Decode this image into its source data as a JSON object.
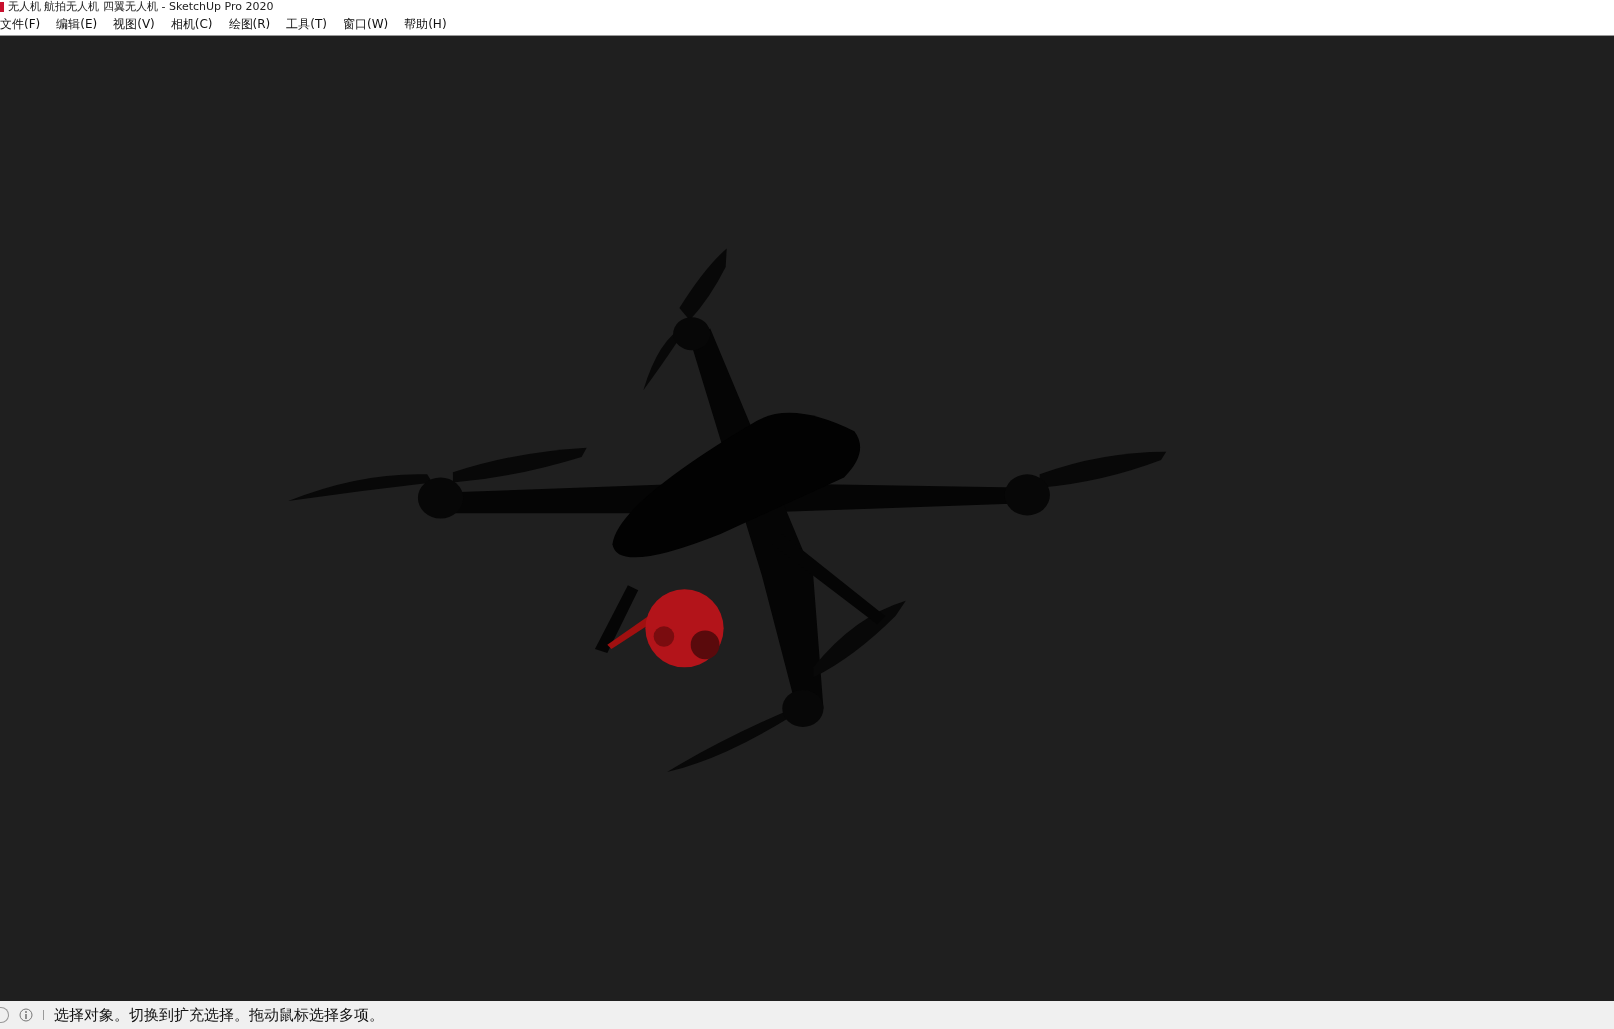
{
  "window": {
    "title": "无人机 航拍无人机 四翼无人机 - SketchUp Pro 2020"
  },
  "menu": [
    "文件(F)",
    "编辑(E)",
    "视图(V)",
    "相机(C)",
    "绘图(R)",
    "工具(T)",
    "窗口(W)",
    "帮助(H)"
  ],
  "viewport": {
    "kind": "model"
  },
  "status_bar": {
    "message": "选择对象。切换到扩充选择。拖动鼠标选择多项。"
  }
}
